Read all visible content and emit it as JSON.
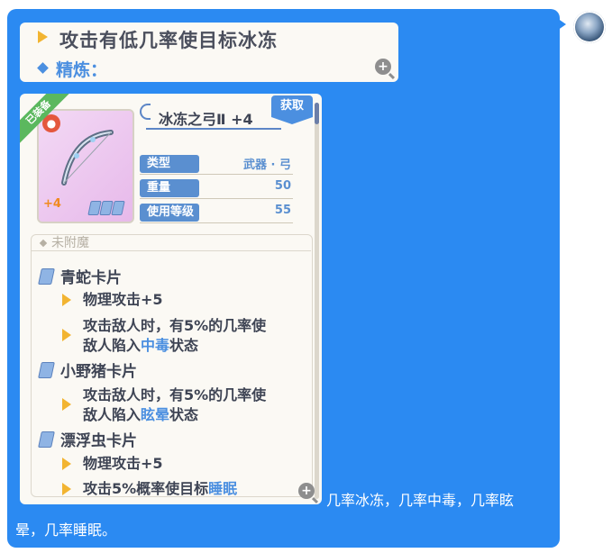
{
  "message": {
    "card_header": {
      "title": "攻击有低几率使目标冰冻",
      "refine_label": "精炼："
    },
    "item_card": {
      "equipped_label": "已装备",
      "item_name": "冰冻之弓Ⅱ +4",
      "obtain_label": "获取",
      "refine_level": "+4",
      "card_slot_count": 3,
      "stats": [
        {
          "label": "类型",
          "value": "武器 · 弓"
        },
        {
          "label": "重量",
          "value": "50"
        },
        {
          "label": "使用等级",
          "value": "55"
        }
      ],
      "enchant_label": "未附魔",
      "cards": [
        {
          "name": "青蛇卡片",
          "effects": [
            {
              "lines": [
                {
                  "text": "物理攻击+5"
                }
              ]
            },
            {
              "lines": [
                {
                  "text": "攻击敌人时，有5%的几率使"
                },
                {
                  "pre": "敌人陷入",
                  "hl": "中毒",
                  "post": "状态"
                }
              ]
            }
          ]
        },
        {
          "name": "小野猪卡片",
          "effects": [
            {
              "lines": [
                {
                  "text": "攻击敌人时，有5%的几率使"
                },
                {
                  "pre": "敌人陷入",
                  "hl": "眩晕",
                  "post": "状态"
                }
              ]
            }
          ]
        },
        {
          "name": "漂浮虫卡片",
          "effects": [
            {
              "lines": [
                {
                  "text": "物理攻击+5"
                }
              ]
            },
            {
              "lines": [
                {
                  "pre": "攻击5%概率使目标",
                  "hl": "睡眠",
                  "post": ""
                }
              ]
            }
          ]
        }
      ]
    },
    "trailing_text_line1": "几率冰冻，几率中毒，几率眩",
    "trailing_text_line2": "晕，几率睡眠。"
  },
  "icons": {
    "triangle": "play-triangle-icon",
    "zoom": "zoom-in-icon",
    "lock": "lock-icon",
    "card": "card-icon",
    "bow": "bow-icon"
  },
  "colors": {
    "bubble": "#2b8af2",
    "card_bg": "#fbf9f4",
    "accent_blue": "#4b8fe0",
    "highlight": "#4b8fe0",
    "triangle": "#f2b431",
    "equipped_badge": "#5bb85e",
    "refine_number": "#f08a1e",
    "item_bg": "#e7b9ea"
  }
}
